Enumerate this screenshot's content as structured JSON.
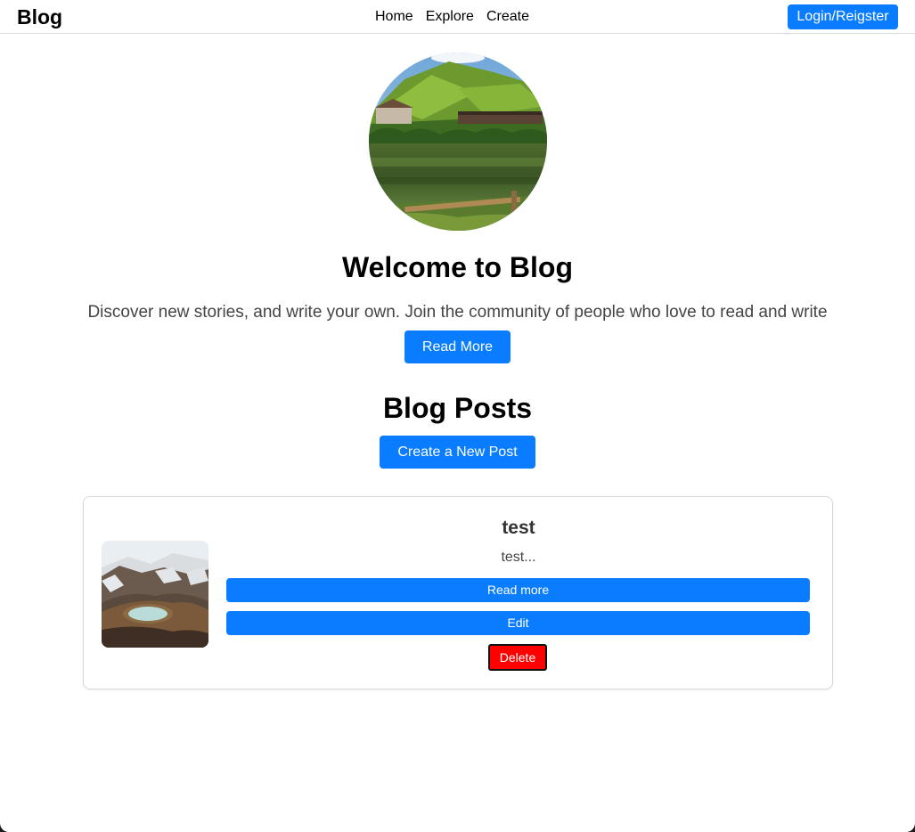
{
  "navbar": {
    "brand": "Blog",
    "links": [
      {
        "label": "Home"
      },
      {
        "label": "Explore"
      },
      {
        "label": "Create"
      }
    ],
    "login_label": "Login/Reigster"
  },
  "hero": {
    "image_alt": "lake and green hills",
    "title": "Welcome to Blog",
    "subtitle": "Discover new stories, and write your own. Join the community of people who love to read and write",
    "read_more_label": "Read More"
  },
  "posts_section": {
    "title": "Blog Posts",
    "create_label": "Create a New Post",
    "posts": [
      {
        "image_alt": "snowy crater lake",
        "title": "test",
        "excerpt": "test...",
        "read_more_label": "Read more",
        "edit_label": "Edit",
        "delete_label": "Delete"
      }
    ]
  },
  "colors": {
    "primary": "#0a7cff",
    "danger": "#ff0000"
  }
}
